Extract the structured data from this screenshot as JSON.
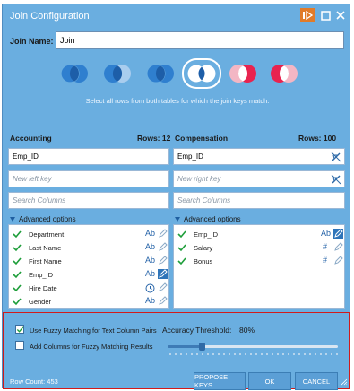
{
  "window": {
    "title": "Join Configuration",
    "buttons": [
      "run-icon",
      "maximize-icon",
      "close-icon"
    ]
  },
  "join_name": {
    "label": "Join Name:",
    "value": "Join"
  },
  "join_types": [
    {
      "name": "inner",
      "selected": false
    },
    {
      "name": "left-outer",
      "selected": false
    },
    {
      "name": "right-outer",
      "selected": false
    },
    {
      "name": "full-outer",
      "selected": true
    },
    {
      "name": "left-anti",
      "selected": false
    },
    {
      "name": "right-anti",
      "selected": false
    }
  ],
  "join_description": "Select all rows from both tables for which the join keys match.",
  "left_table": {
    "name": "Accounting",
    "rows_label": "Rows: 12",
    "key_value": "Emp_ID",
    "new_key_placeholder": "New left key",
    "search_placeholder": "Search Columns",
    "advanced_label": "Advanced options",
    "columns": [
      {
        "name": "Department",
        "type": "Ab"
      },
      {
        "name": "Last Name",
        "type": "Ab"
      },
      {
        "name": "First Name",
        "type": "Ab"
      },
      {
        "name": "Emp_ID",
        "type": "Ab"
      },
      {
        "name": "Hire Date",
        "type": "clock-icon"
      },
      {
        "name": "Gender",
        "type": "Ab"
      }
    ]
  },
  "right_table": {
    "name": "Compensation",
    "rows_label": "Rows: 100",
    "key_value": "Emp_ID",
    "new_key_placeholder": "New right key",
    "search_placeholder": "Search Columns",
    "advanced_label": "Advanced options",
    "columns": [
      {
        "name": "Emp_ID",
        "type": "Ab"
      },
      {
        "name": "Salary",
        "type": "#"
      },
      {
        "name": "Bonus",
        "type": "#"
      }
    ]
  },
  "fuzzy": {
    "use_fuzzy_label": "Use Fuzzy Matching for Text Column Pairs",
    "use_fuzzy_checked": true,
    "add_columns_label": "Add Columns for Fuzzy Matching Results",
    "add_columns_checked": false,
    "accuracy_label": "Accuracy Threshold:",
    "accuracy_value": "80%",
    "slider_level": 0.2
  },
  "footer": {
    "row_count": "Row Count: 453",
    "propose_keys": "PROPOSE KEYS",
    "ok": "OK",
    "cancel": "CANCEL"
  },
  "colors": {
    "dialog_bg": "#6aaee0",
    "accent": "#1f5fa0",
    "highlight": "#d11a1a",
    "run_button": "#e07b2a"
  }
}
